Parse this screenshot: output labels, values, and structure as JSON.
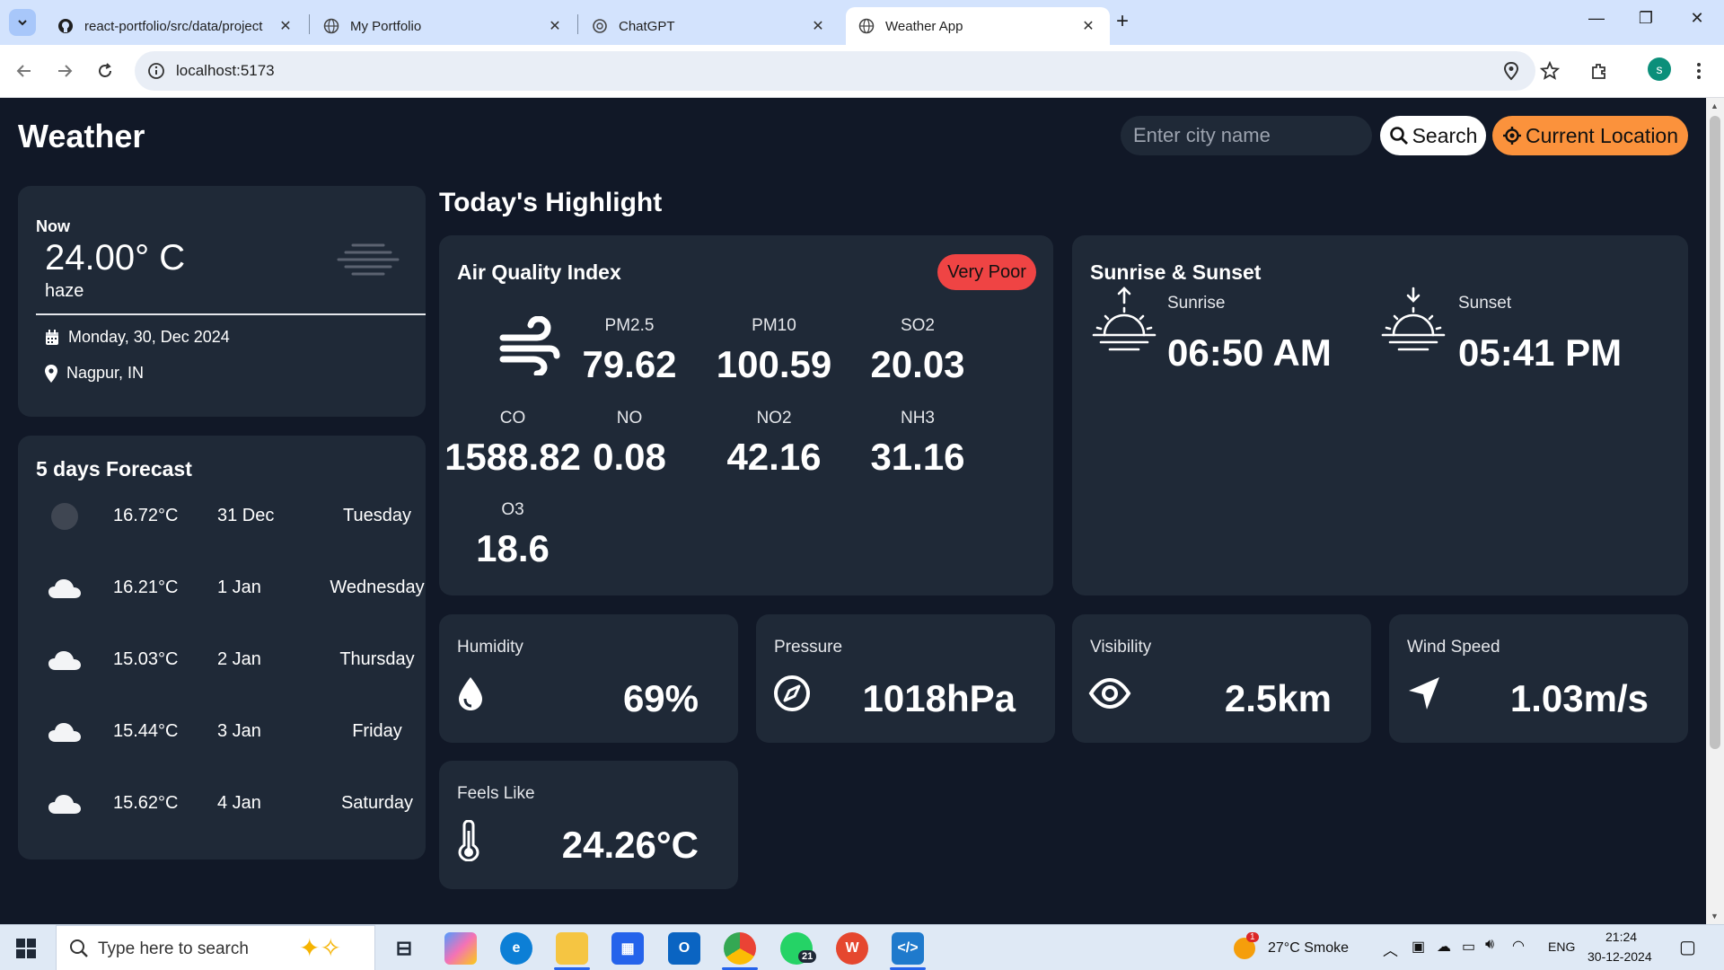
{
  "browser": {
    "tabs": [
      {
        "title": "react-portfolio/src/data/project",
        "icon": "github-icon",
        "active": false
      },
      {
        "title": "My Portfolio",
        "icon": "globe-icon",
        "active": false
      },
      {
        "title": "ChatGPT",
        "icon": "openai-icon",
        "active": false
      },
      {
        "title": "Weather App",
        "icon": "globe-icon",
        "active": true
      }
    ],
    "url": "localhost:5173",
    "profile_initial": "s"
  },
  "header": {
    "logo": "Weather",
    "search_placeholder": "Enter city name",
    "search_label": "Search",
    "location_label": "Current Location"
  },
  "current": {
    "label": "Now",
    "temperature": "24.00° C",
    "condition": "haze",
    "date": "Monday, 30, Dec 2024",
    "location": "Nagpur, IN"
  },
  "forecast": {
    "title": "5 days Forecast",
    "days": [
      {
        "temp": "16.72°C",
        "date": "31 Dec",
        "weekday": "Tuesday",
        "icon": "dark-circle-icon"
      },
      {
        "temp": "16.21°C",
        "date": "1 Jan",
        "weekday": "Wednesday",
        "icon": "cloud-icon"
      },
      {
        "temp": "15.03°C",
        "date": "2 Jan",
        "weekday": "Thursday",
        "icon": "cloud-icon"
      },
      {
        "temp": "15.44°C",
        "date": "3 Jan",
        "weekday": "Friday",
        "icon": "cloud-icon"
      },
      {
        "temp": "15.62°C",
        "date": "4 Jan",
        "weekday": "Saturday",
        "icon": "cloud-icon"
      }
    ]
  },
  "highlights": {
    "title": "Today's Highlight",
    "aqi": {
      "title": "Air Quality Index",
      "badge": "Very Poor",
      "badge_color": "#ef4444",
      "items": [
        {
          "name": "PM2.5",
          "value": "79.62"
        },
        {
          "name": "PM10",
          "value": "100.59"
        },
        {
          "name": "SO2",
          "value": "20.03"
        },
        {
          "name": "CO",
          "value": "1588.82"
        },
        {
          "name": "NO",
          "value": "0.08"
        },
        {
          "name": "NO2",
          "value": "42.16"
        },
        {
          "name": "NH3",
          "value": "31.16"
        },
        {
          "name": "O3",
          "value": "18.6"
        }
      ]
    },
    "sun": {
      "title": "Sunrise & Sunset",
      "sunrise_label": "Sunrise",
      "sunrise_time": "06:50 AM",
      "sunset_label": "Sunset",
      "sunset_time": "05:41 PM"
    },
    "humidity": {
      "label": "Humidity",
      "value": "69%"
    },
    "pressure": {
      "label": "Pressure",
      "value": "1018hPa"
    },
    "visibility": {
      "label": "Visibility",
      "value": "2.5km"
    },
    "wind": {
      "label": "Wind Speed",
      "value": "1.03m/s"
    },
    "feels_like": {
      "label": "Feels Like",
      "value": "24.26°C"
    }
  },
  "taskbar": {
    "search_placeholder": "Type here to search",
    "weather": "27°C  Smoke",
    "language": "ENG",
    "time": "21:24",
    "date": "30-12-2024",
    "whatsapp_badge": "21",
    "weather_badge": "1"
  },
  "colors": {
    "page_bg": "#111827",
    "card_bg": "#1f2937",
    "accent_orange": "#fb923c",
    "aqi_badge_red": "#ef4444"
  }
}
